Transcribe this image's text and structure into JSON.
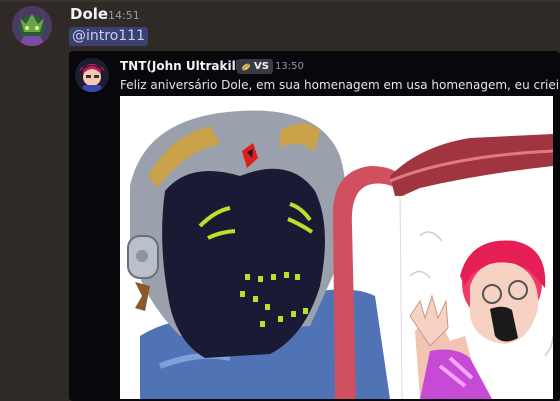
{
  "message": {
    "author": "Dole",
    "timestamp": "14:51",
    "mention": "@intro111"
  },
  "embed": {
    "author": "TNT(John Ultrakill)",
    "tag": "VS",
    "timestamp": "13:50",
    "text": "Feliz aniversário Dole, em sua homenagem em usa homenagem, eu criei isso:"
  },
  "icons": {
    "user_avatar": "character-avatar",
    "embed_avatar": "character-avatar",
    "tag_icon": "leaf-icon"
  },
  "colors": {
    "background": "#2f2a25",
    "mention_bg": "#3c4270",
    "mention_text": "#c9cdfb",
    "embed_bg": "#07070c"
  }
}
